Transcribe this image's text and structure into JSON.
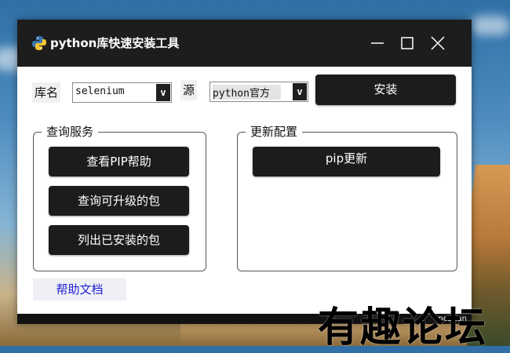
{
  "window": {
    "title": "python库快速安装工具",
    "icon": "python-logo"
  },
  "install_row": {
    "lib_label": "库名",
    "lib_value": "selenium",
    "source_label": "源",
    "source_value": "python官方",
    "dropdown_glyph": "v",
    "install_button": "安装"
  },
  "query_group": {
    "title": "查询服务",
    "buttons": [
      "查看PIP帮助",
      "查询可升级的包",
      "列出已安装的包"
    ]
  },
  "update_group": {
    "title": "更新配置",
    "buttons": [
      "pip更新"
    ]
  },
  "help_button": "帮助文档",
  "statusbar_text": "pozhan",
  "watermark": "有趣论坛",
  "colors": {
    "titlebar": "#1d1d1d",
    "button_bg": "#1c1c1c",
    "button_text": "#ffffff",
    "link_text": "#1f1fd0",
    "help_bg": "#eef0f5"
  }
}
